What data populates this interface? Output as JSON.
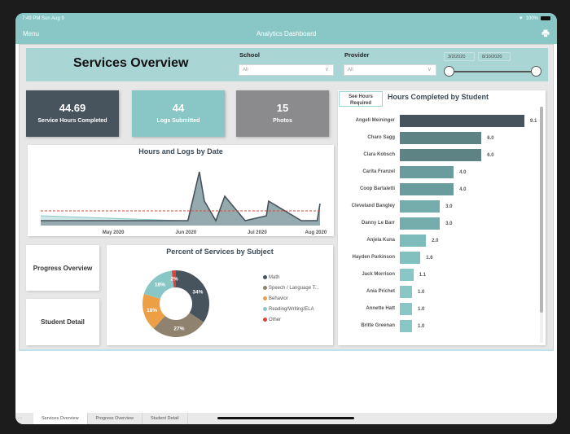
{
  "status_bar": {
    "time": "7:49 PM  Sun Aug 9",
    "battery": "100%"
  },
  "nav": {
    "menu_label": "Menu",
    "title": "Analytics Dashboard",
    "print_icon": "printer-icon"
  },
  "header": {
    "title": "Services Overview",
    "school": {
      "label": "School",
      "value": "All"
    },
    "provider": {
      "label": "Provider",
      "value": "All"
    },
    "date_range": {
      "start": "3/2/2020",
      "end": "8/10/2020",
      "start_fraction": 0.0,
      "end_fraction": 1.0
    }
  },
  "kpis": [
    {
      "value": "44.69",
      "label": "Service Hours Completed",
      "color": "#47535d"
    },
    {
      "value": "44",
      "label": "Logs Submitted",
      "color": "#88c7c5"
    },
    {
      "value": "15",
      "label": "Photos",
      "color": "#8b8b8d"
    }
  ],
  "nav_cards": {
    "progress": "Progress Overview",
    "student": "Student Detail"
  },
  "see_hours_button": "See Hours Required",
  "tabs": [
    "Services Overview",
    "Progress Overview",
    "Student Detail"
  ],
  "chart_data": [
    {
      "type": "area",
      "title": "Hours and Logs by Date",
      "x_ticks": [
        "May 2020",
        "Jun 2020",
        "Jul 2020",
        "Aug 2020"
      ],
      "x_range": [
        "2020-04-05",
        "2020-08-08"
      ],
      "y_range": [
        0,
        12
      ],
      "series": [
        {
          "name": "Hours",
          "color": "#47535d",
          "fill": "#95aaae",
          "x": [
            0,
            0.527,
            0.568,
            0.586,
            0.627,
            0.659,
            0.732,
            0.808,
            0.816,
            0.933,
            0.99,
            1.0
          ],
          "y": [
            1,
            1,
            11,
            5,
            1,
            6,
            1,
            2,
            5,
            1,
            1,
            4.5
          ]
        },
        {
          "name": "Logs",
          "color": "#88c7c5",
          "fill": "#cfe8e7",
          "x": [
            0,
            0.5,
            1.0
          ],
          "y": [
            2,
            1,
            1
          ]
        }
      ],
      "reference_line": {
        "value": 3,
        "color": "#e04a3f",
        "style": "dashed"
      }
    },
    {
      "type": "pie",
      "title": "Percent of Services by Subject",
      "donut": true,
      "slices": [
        {
          "label": "Math",
          "value": 34,
          "color": "#47535d"
        },
        {
          "label": "Speech / Language T...",
          "value": 27,
          "color": "#8f836f"
        },
        {
          "label": "Behavior",
          "value": 18,
          "color": "#ec9f45"
        },
        {
          "label": "Reading/Writing/ELA",
          "value": 18,
          "color": "#88c7c5"
        },
        {
          "label": "Other",
          "value": 2,
          "color": "#e0413a"
        }
      ],
      "legend_position": "right"
    },
    {
      "type": "bar",
      "orientation": "horizontal",
      "title": "Hours Completed by Student",
      "categories": [
        "Angeli Meininger",
        "Charo Sagg",
        "Clara Kobsch",
        "Carita Franzel",
        "Coop Bartaletti",
        "Cleveland Bangley",
        "Danny Le Barr",
        "Anjela Kuna",
        "Hayden Parkinson",
        "Jack Morrison",
        "Ania Prichet",
        "Annette Hatt",
        "Britte Greenan"
      ],
      "values": [
        9.1,
        6.0,
        6.0,
        4.0,
        4.0,
        3.0,
        3.0,
        2.0,
        1.6,
        1.1,
        1.0,
        1.0,
        1.0
      ],
      "labels": [
        "9.1",
        "6.0",
        "6.0",
        "4.0",
        "4.0",
        "3.0",
        "3.0",
        "2.0",
        "1.6",
        "1.1",
        "1.0",
        "1.0",
        "1.0"
      ],
      "colors": [
        "#47535d",
        "#5e8385",
        "#5e8385",
        "#6a9c9d",
        "#6a9c9d",
        "#75adad",
        "#75adad",
        "#7dbcbb",
        "#80c0be",
        "#88c7c5",
        "#88c7c5",
        "#88c7c5",
        "#88c7c5"
      ],
      "xlim": [
        0,
        9.1
      ]
    }
  ]
}
